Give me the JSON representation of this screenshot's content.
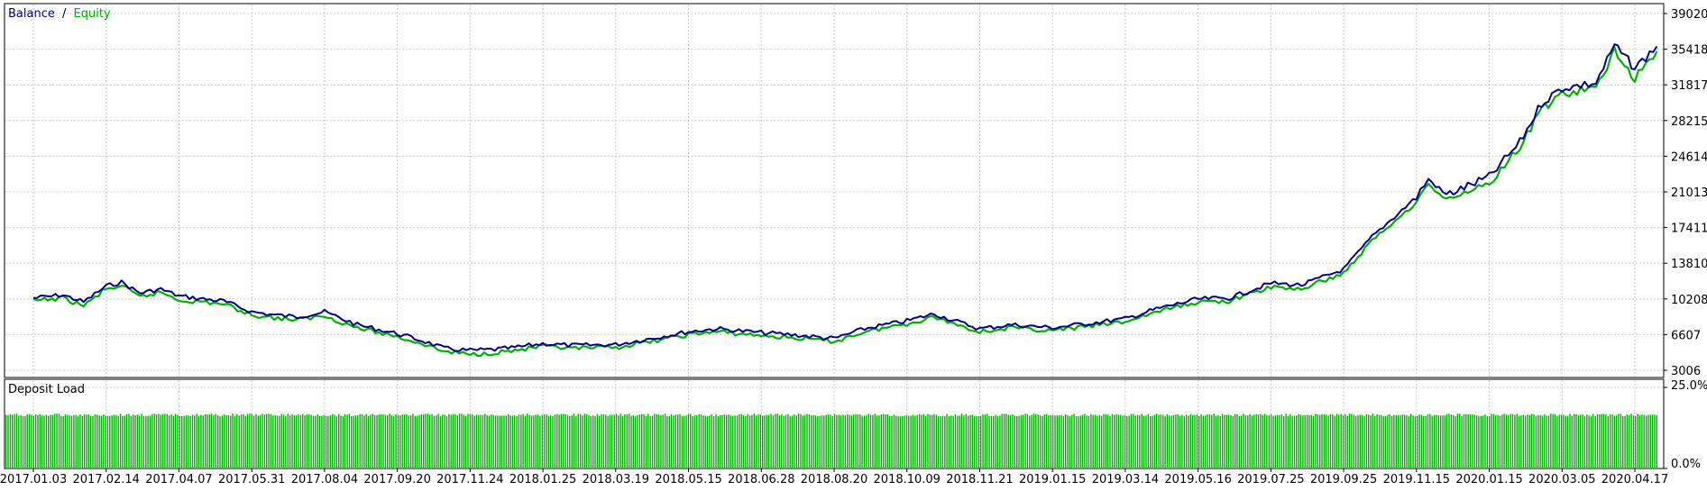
{
  "chart_data": [
    {
      "type": "line",
      "legend": {
        "placement": "top-left",
        "separator": "/",
        "entries": [
          {
            "name": "Balance",
            "color": "#00008b"
          },
          {
            "name": "Equity",
            "color": "#00b000"
          }
        ]
      },
      "y_ticks": [
        "39020",
        "35418",
        "31817",
        "28215",
        "24614",
        "21013",
        "17411",
        "13810",
        "10208",
        "6607",
        "3006"
      ],
      "ylim": [
        3006,
        39020
      ],
      "grid": true,
      "x_tick_labels": [
        "2017.01.03",
        "2017.02.14",
        "2017.04.07",
        "2017.05.31",
        "2017.08.04",
        "2017.09.20",
        "2017.11.24",
        "2018.01.25",
        "2018.03.19",
        "2018.05.15",
        "2018.06.28",
        "2018.08.20",
        "2018.10.09",
        "2018.11.21",
        "2019.01.15",
        "2019.03.14",
        "2019.05.16",
        "2019.07.25",
        "2019.09.25",
        "2019.11.15",
        "2020.01.15",
        "2020.03.05",
        "2020.04.17"
      ],
      "series": [
        {
          "name": "Balance",
          "color": "#00008b",
          "points": [
            [
              "2017.01.03",
              10300
            ],
            [
              "2017.01.20",
              10600
            ],
            [
              "2017.02.01",
              9900
            ],
            [
              "2017.02.14",
              11500
            ],
            [
              "2017.02.25",
              11900
            ],
            [
              "2017.03.10",
              10800
            ],
            [
              "2017.03.25",
              11200
            ],
            [
              "2017.04.07",
              10500
            ],
            [
              "2017.04.25",
              10200
            ],
            [
              "2017.05.10",
              10000
            ],
            [
              "2017.05.31",
              8900
            ],
            [
              "2017.06.20",
              8600
            ],
            [
              "2017.07.10",
              8400
            ],
            [
              "2017.08.04",
              8900
            ],
            [
              "2017.08.25",
              7600
            ],
            [
              "2017.09.20",
              6700
            ],
            [
              "2017.10.15",
              5900
            ],
            [
              "2017.11.01",
              5200
            ],
            [
              "2017.11.24",
              5000
            ],
            [
              "2017.12.15",
              5100
            ],
            [
              "2018.01.01",
              5300
            ],
            [
              "2018.01.25",
              5700
            ],
            [
              "2018.02.15",
              5500
            ],
            [
              "2018.03.19",
              5600
            ],
            [
              "2018.04.15",
              6200
            ],
            [
              "2018.05.15",
              6900
            ],
            [
              "2018.06.01",
              7200
            ],
            [
              "2018.06.28",
              6800
            ],
            [
              "2018.07.20",
              6600
            ],
            [
              "2018.08.20",
              6200
            ],
            [
              "2018.09.10",
              7200
            ],
            [
              "2018.10.09",
              8000
            ],
            [
              "2018.10.25",
              8700
            ],
            [
              "2018.11.10",
              7800
            ],
            [
              "2018.11.21",
              7200
            ],
            [
              "2018.12.15",
              7600
            ],
            [
              "2019.01.15",
              7300
            ],
            [
              "2019.02.10",
              7700
            ],
            [
              "2019.03.14",
              8200
            ],
            [
              "2019.04.10",
              9200
            ],
            [
              "2019.05.16",
              10200
            ],
            [
              "2019.06.15",
              10300
            ],
            [
              "2019.07.25",
              11800
            ],
            [
              "2019.08.20",
              11600
            ],
            [
              "2019.09.25",
              13200
            ],
            [
              "2019.10.15",
              16500
            ],
            [
              "2019.11.15",
              20500
            ],
            [
              "2019.11.25",
              22300
            ],
            [
              "2019.12.10",
              20700
            ],
            [
              "2020.01.15",
              22500
            ],
            [
              "2020.02.05",
              26000
            ],
            [
              "2020.02.20",
              30000
            ],
            [
              "2020.03.05",
              31500
            ],
            [
              "2020.03.25",
              32000
            ],
            [
              "2020.04.05",
              35800
            ],
            [
              "2020.04.17",
              33500
            ],
            [
              "2020.04.30",
              35700
            ]
          ]
        },
        {
          "name": "Equity",
          "color": "#00b000",
          "points": [
            [
              "2017.01.03",
              10000
            ],
            [
              "2017.01.20",
              10300
            ],
            [
              "2017.02.01",
              9500
            ],
            [
              "2017.02.14",
              11200
            ],
            [
              "2017.02.25",
              11500
            ],
            [
              "2017.03.10",
              10400
            ],
            [
              "2017.03.25",
              10900
            ],
            [
              "2017.04.07",
              10100
            ],
            [
              "2017.04.25",
              9900
            ],
            [
              "2017.05.10",
              9700
            ],
            [
              "2017.05.31",
              8600
            ],
            [
              "2017.06.20",
              8300
            ],
            [
              "2017.07.10",
              8100
            ],
            [
              "2017.08.04",
              8500
            ],
            [
              "2017.08.25",
              7300
            ],
            [
              "2017.09.20",
              6400
            ],
            [
              "2017.10.15",
              5600
            ],
            [
              "2017.11.01",
              4900
            ],
            [
              "2017.11.24",
              4600
            ],
            [
              "2017.12.15",
              4800
            ],
            [
              "2018.01.01",
              5000
            ],
            [
              "2018.01.25",
              5400
            ],
            [
              "2018.02.15",
              5200
            ],
            [
              "2018.03.19",
              5300
            ],
            [
              "2018.04.15",
              5900
            ],
            [
              "2018.05.15",
              6600
            ],
            [
              "2018.06.01",
              6900
            ],
            [
              "2018.06.28",
              6500
            ],
            [
              "2018.07.20",
              6300
            ],
            [
              "2018.08.20",
              5900
            ],
            [
              "2018.09.10",
              6900
            ],
            [
              "2018.10.09",
              7700
            ],
            [
              "2018.10.25",
              8400
            ],
            [
              "2018.11.10",
              7500
            ],
            [
              "2018.11.21",
              6900
            ],
            [
              "2018.12.15",
              7300
            ],
            [
              "2019.01.15",
              7000
            ],
            [
              "2019.02.10",
              7400
            ],
            [
              "2019.03.14",
              7900
            ],
            [
              "2019.04.10",
              8900
            ],
            [
              "2019.05.16",
              9900
            ],
            [
              "2019.06.15",
              10000
            ],
            [
              "2019.07.25",
              11400
            ],
            [
              "2019.08.20",
              11200
            ],
            [
              "2019.09.25",
              12800
            ],
            [
              "2019.10.15",
              16100
            ],
            [
              "2019.11.15",
              20000
            ],
            [
              "2019.11.25",
              21800
            ],
            [
              "2019.12.10",
              20200
            ],
            [
              "2020.01.15",
              22000
            ],
            [
              "2020.02.05",
              25400
            ],
            [
              "2020.02.20",
              29400
            ],
            [
              "2020.03.05",
              30900
            ],
            [
              "2020.03.25",
              31400
            ],
            [
              "2020.04.05",
              35200
            ],
            [
              "2020.04.17",
              32500
            ],
            [
              "2020.04.30",
              35200
            ]
          ]
        }
      ]
    },
    {
      "type": "bar",
      "title": "Deposit Load",
      "y_ticks": [
        "25.0%",
        "0.0%"
      ],
      "ylim": [
        0,
        25
      ],
      "grid": true,
      "bar_color": "#00b000",
      "typical_load_percent": 16.5
    }
  ]
}
